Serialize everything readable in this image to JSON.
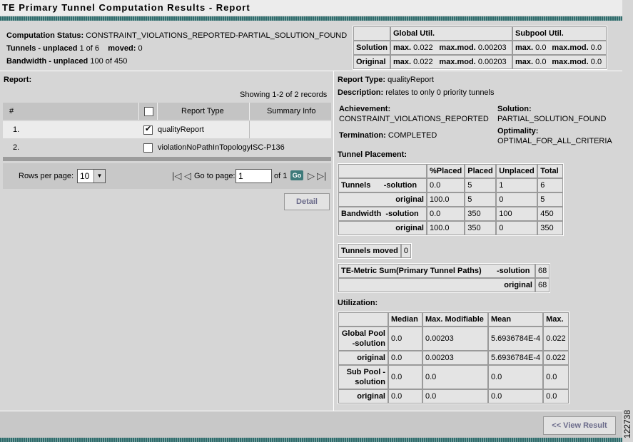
{
  "title": "TE Primary Tunnel Computation Results - Report",
  "status": {
    "computation_label": "Computation Status:",
    "computation_value": "CONSTRAINT_VIOLATIONS_REPORTED-PARTIAL_SOLUTION_FOUND",
    "tunnels_label": "Tunnels - unplaced",
    "tunnels_value": "1 of 6",
    "moved_label": "moved:",
    "moved_value": "0",
    "bandwidth_label": "Bandwidth - unplaced",
    "bandwidth_value": "100 of 450"
  },
  "util_table": {
    "headers": [
      "",
      "Global Util.",
      "",
      "Subpool Util.",
      ""
    ],
    "rows": [
      {
        "label": "Solution",
        "g_max": "max.",
        "g_max_v": "0.022",
        "g_mod": "max.mod.",
        "g_mod_v": "0.00203",
        "s_max": "max.",
        "s_max_v": "0.0",
        "s_mod": "max.mod.",
        "s_mod_v": "0.0"
      },
      {
        "label": "Original",
        "g_max": "max.",
        "g_max_v": "0.022",
        "g_mod": "max.mod.",
        "g_mod_v": "0.00203",
        "s_max": "max.",
        "s_max_v": "0.0",
        "s_mod": "max.mod.",
        "s_mod_v": "0.0"
      }
    ]
  },
  "left": {
    "report_label": "Report:",
    "showing": "Showing 1-2 of 2 records",
    "columns": [
      "#",
      "Report Type",
      "Summary Info"
    ],
    "rows": [
      {
        "num": "1.",
        "type": "qualityReport",
        "summary": "",
        "checked": true
      },
      {
        "num": "2.",
        "type": "violationNoPathInTopology",
        "summary": "ISC-P136",
        "checked": false
      }
    ],
    "rows_per_page_label": "Rows per page:",
    "rows_per_page": "10",
    "goto_label": "Go to page:",
    "goto_value": "1",
    "of_label": "of 1",
    "go": "Go",
    "detail": "Detail"
  },
  "right": {
    "report_type_label": "Report Type:",
    "report_type": "qualityReport",
    "description_label": "Description:",
    "description": "relates to only 0 priority tunnels",
    "achievement_label": "Achievement:",
    "achievement": "CONSTRAINT_VIOLATIONS_REPORTED",
    "solution_label": "Solution:",
    "solution": "PARTIAL_SOLUTION_FOUND",
    "termination_label": "Termination:",
    "termination": "COMPLETED",
    "optimality_label": "Optimality:",
    "optimality": "OPTIMAL_FOR_ALL_CRITERIA",
    "placement_label": "Tunnel Placement:",
    "placement_headers": [
      "",
      "%Placed",
      "Placed",
      "Unplaced",
      "Total"
    ],
    "placement_rows": [
      [
        "Tunnels      -solution",
        "0.0",
        "5",
        "1",
        "6"
      ],
      [
        "original",
        "100.0",
        "5",
        "0",
        "5"
      ],
      [
        "Bandwidth  -solution",
        "0.0",
        "350",
        "100",
        "450"
      ],
      [
        "original",
        "100.0",
        "350",
        "0",
        "350"
      ]
    ],
    "moved_label": "Tunnels moved",
    "moved_value": "0",
    "metric_label": "TE-Metric Sum(Primary Tunnel Paths)",
    "metric_sol_label": "-solution",
    "metric_sol": "68",
    "metric_orig_label": "original",
    "metric_orig": "68",
    "utilization_label": "Utilization:",
    "util_headers": [
      "",
      "Median",
      "Max. Modifiable",
      "Mean",
      "Max."
    ],
    "util_rows": [
      [
        "Global Pool -solution",
        "0.0",
        "0.00203",
        "5.6936784E-4",
        "0.022"
      ],
      [
        "original",
        "0.0",
        "0.00203",
        "5.6936784E-4",
        "0.022"
      ],
      [
        "Sub Pool -solution",
        "0.0",
        "0.0",
        "0.0",
        "0.0"
      ],
      [
        "original",
        "0.0",
        "0.0",
        "0.0",
        "0.0"
      ]
    ]
  },
  "footer": {
    "view_result": "<< View Result",
    "stamp": "122738"
  }
}
